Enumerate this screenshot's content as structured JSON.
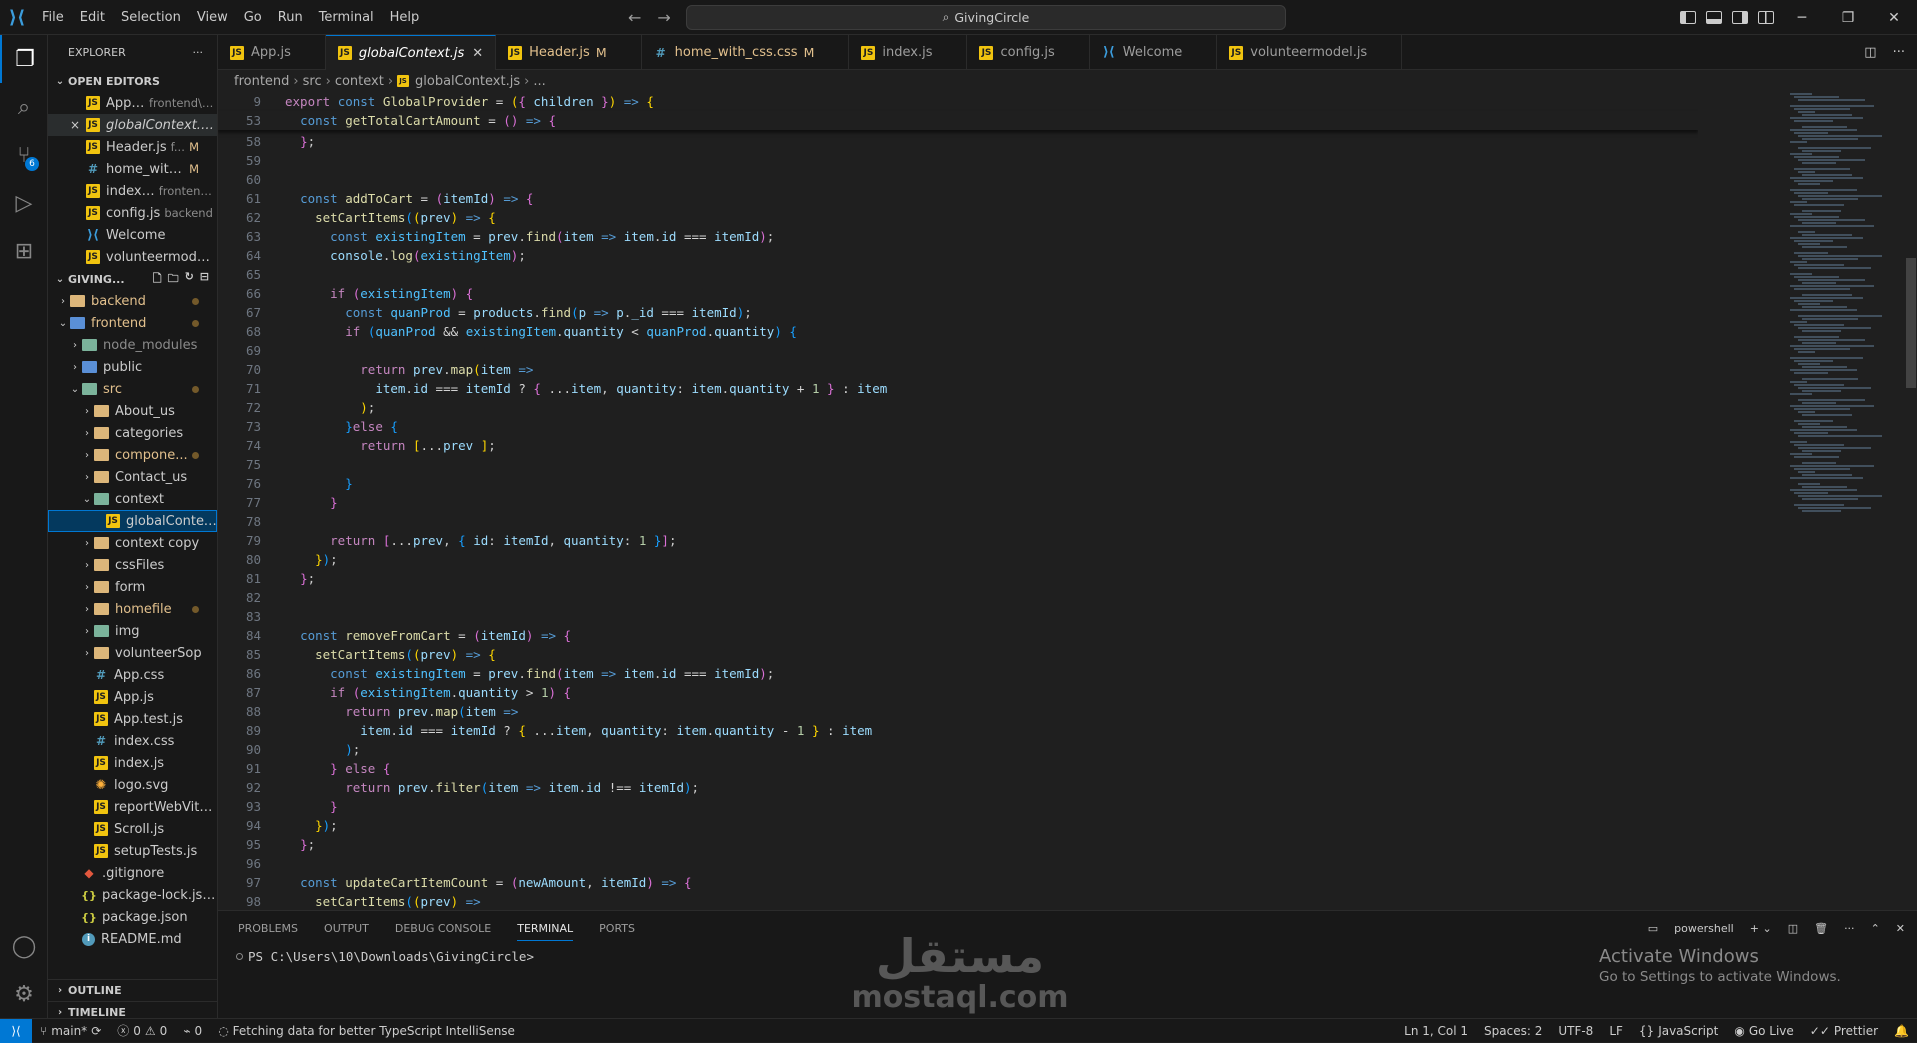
{
  "window": {
    "title": "GivingCircle"
  },
  "menu": [
    "File",
    "Edit",
    "Selection",
    "View",
    "Go",
    "Run",
    "Terminal",
    "Help"
  ],
  "activity": {
    "scm_badge": "6"
  },
  "explorer": {
    "title": "EXPLORER",
    "open_editors_label": "OPEN EDITORS",
    "open_editors": [
      {
        "name": "App.js",
        "desc": "frontend\\src",
        "mod": "",
        "icon": "js"
      },
      {
        "name": "globalContext.js...",
        "desc": "",
        "mod": "",
        "icon": "js",
        "close": "×"
      },
      {
        "name": "Header.js",
        "desc": "f...",
        "mod": "M",
        "icon": "js"
      },
      {
        "name": "home_with...",
        "desc": "",
        "mod": "M",
        "icon": "css"
      },
      {
        "name": "index.js",
        "desc": "frontend...",
        "mod": "",
        "icon": "js"
      },
      {
        "name": "config.js",
        "desc": "backend",
        "mod": "",
        "icon": "js"
      },
      {
        "name": "Welcome",
        "desc": "",
        "mod": "",
        "icon": "vs"
      },
      {
        "name": "volunteermodel...",
        "desc": "",
        "mod": "",
        "icon": "js"
      }
    ],
    "project_label": "GIVING...",
    "tree": [
      {
        "name": "backend",
        "indent": 0,
        "type": "folder",
        "open": false,
        "dot": true
      },
      {
        "name": "frontend",
        "indent": 0,
        "type": "folder",
        "open": true,
        "dot": true,
        "color": "blue"
      },
      {
        "name": "node_modules",
        "indent": 1,
        "type": "folder",
        "open": false,
        "dim": true,
        "color": "green"
      },
      {
        "name": "public",
        "indent": 1,
        "type": "folder",
        "open": false,
        "color": "blue"
      },
      {
        "name": "src",
        "indent": 1,
        "type": "folder",
        "open": true,
        "dot": true,
        "color": "green"
      },
      {
        "name": "About_us",
        "indent": 2,
        "type": "folder",
        "open": false
      },
      {
        "name": "categories",
        "indent": 2,
        "type": "folder",
        "open": false
      },
      {
        "name": "compone...",
        "indent": 2,
        "type": "folder",
        "open": false,
        "dot": true
      },
      {
        "name": "Contact_us",
        "indent": 2,
        "type": "folder",
        "open": false
      },
      {
        "name": "context",
        "indent": 2,
        "type": "folder",
        "open": true,
        "color": "green"
      },
      {
        "name": "globalContex...",
        "indent": 3,
        "type": "js",
        "selected": true
      },
      {
        "name": "context copy",
        "indent": 2,
        "type": "folder",
        "open": false
      },
      {
        "name": "cssFiles",
        "indent": 2,
        "type": "folder",
        "open": false
      },
      {
        "name": "form",
        "indent": 2,
        "type": "folder",
        "open": false
      },
      {
        "name": "homefile",
        "indent": 2,
        "type": "folder",
        "open": false,
        "dot": true
      },
      {
        "name": "img",
        "indent": 2,
        "type": "folder",
        "open": false,
        "color": "green"
      },
      {
        "name": "volunteerSop",
        "indent": 2,
        "type": "folder",
        "open": false
      },
      {
        "name": "App.css",
        "indent": 2,
        "type": "css"
      },
      {
        "name": "App.js",
        "indent": 2,
        "type": "js"
      },
      {
        "name": "App.test.js",
        "indent": 2,
        "type": "js"
      },
      {
        "name": "index.css",
        "indent": 2,
        "type": "css"
      },
      {
        "name": "index.js",
        "indent": 2,
        "type": "js"
      },
      {
        "name": "logo.svg",
        "indent": 2,
        "type": "svg"
      },
      {
        "name": "reportWebVital...",
        "indent": 2,
        "type": "js"
      },
      {
        "name": "Scroll.js",
        "indent": 2,
        "type": "js"
      },
      {
        "name": "setupTests.js",
        "indent": 2,
        "type": "js"
      },
      {
        "name": ".gitignore",
        "indent": 1,
        "type": "git"
      },
      {
        "name": "package-lock.json",
        "indent": 1,
        "type": "json"
      },
      {
        "name": "package.json",
        "indent": 1,
        "type": "json"
      },
      {
        "name": "README.md",
        "indent": 1,
        "type": "info"
      }
    ],
    "outline_label": "OUTLINE",
    "timeline_label": "TIMELINE"
  },
  "tabs": [
    {
      "name": "App.js",
      "icon": "js",
      "mod": "",
      "active": false
    },
    {
      "name": "globalContext.js",
      "icon": "js",
      "mod": "",
      "active": true
    },
    {
      "name": "Header.js",
      "icon": "js",
      "mod": "M",
      "active": false
    },
    {
      "name": "home_with_css.css",
      "icon": "css",
      "mod": "M",
      "active": false
    },
    {
      "name": "index.js",
      "icon": "js",
      "mod": "",
      "active": false
    },
    {
      "name": "config.js",
      "icon": "js",
      "mod": "",
      "active": false
    },
    {
      "name": "Welcome",
      "icon": "vs",
      "mod": "",
      "active": false
    },
    {
      "name": "volunteermodel.js",
      "icon": "js",
      "mod": "",
      "active": false
    }
  ],
  "breadcrumb": [
    "frontend",
    "src",
    "context",
    "globalContext.js",
    "..."
  ],
  "code_lines": [
    {
      "n": "9",
      "sticky": true,
      "html": "<span class='kwc'>export</span> <span class='kw'>const</span> <span class='fn'>GlobalProvider</span> <span class='op'>=</span> <span class='b1'>(</span><span class='b2'>{</span> <span class='var'>children</span> <span class='b2'>}</span><span class='b1'>)</span> <span class='kw'>=&gt;</span> <span class='b1'>{</span>"
    },
    {
      "n": "53",
      "sticky": true,
      "html": "  <span class='kw'>const</span> <span class='fn'>getTotalCartAmount</span> <span class='op'>=</span> <span class='b2'>()</span> <span class='kw'>=&gt;</span> <span class='b2'>{</span>"
    },
    {
      "n": "58",
      "html": "  <span class='b2'>}</span>;"
    },
    {
      "n": "59",
      "html": ""
    },
    {
      "n": "60",
      "html": ""
    },
    {
      "n": "61",
      "html": "  <span class='kw'>const</span> <span class='fn'>addToCart</span> <span class='op'>=</span> <span class='b2'>(</span><span class='var'>itemId</span><span class='b2'>)</span> <span class='kw'>=&gt;</span> <span class='b2'>{</span>"
    },
    {
      "n": "62",
      "html": "    <span class='fn'>setCartItems</span><span class='b3'>(</span><span class='b1'>(</span><span class='var'>prev</span><span class='b1'>)</span> <span class='kw'>=&gt;</span> <span class='b1'>{</span>"
    },
    {
      "n": "63",
      "html": "      <span class='kw'>const</span> <span class='cst'>existingItem</span> <span class='op'>=</span> <span class='var'>prev</span>.<span class='fn'>find</span><span class='b2'>(</span><span class='var'>item</span> <span class='kw'>=&gt;</span> <span class='var'>item</span>.<span class='var'>id</span> <span class='op'>===</span> <span class='var'>itemId</span><span class='b2'>)</span>;"
    },
    {
      "n": "64",
      "html": "      <span class='var'>console</span>.<span class='fn'>log</span><span class='b2'>(</span><span class='cst'>existingItem</span><span class='b2'>)</span>;"
    },
    {
      "n": "65",
      "html": ""
    },
    {
      "n": "66",
      "html": "      <span class='kwc'>if</span> <span class='b2'>(</span><span class='cst'>existingItem</span><span class='b2'>)</span> <span class='b2'>{</span>"
    },
    {
      "n": "67",
      "html": "        <span class='kw'>const</span> <span class='cst'>quanProd</span> <span class='op'>=</span> <span class='var'>products</span>.<span class='fn'>find</span><span class='b3'>(</span><span class='var'>p</span> <span class='kw'>=&gt;</span> <span class='var'>p</span>.<span class='var'>_id</span> <span class='op'>===</span> <span class='var'>itemId</span><span class='b3'>)</span>;"
    },
    {
      "n": "68",
      "html": "        <span class='kwc'>if</span> <span class='b3'>(</span><span class='cst'>quanProd</span> <span class='op'>&amp;&amp;</span> <span class='cst'>existingItem</span>.<span class='var'>quantity</span> <span class='op'>&lt;</span> <span class='cst'>quanProd</span>.<span class='var'>quantity</span><span class='b3'>)</span> <span class='b3'>{</span>"
    },
    {
      "n": "69",
      "html": ""
    },
    {
      "n": "70",
      "html": "          <span class='kwc'>return</span> <span class='var'>prev</span>.<span class='fn'>map</span><span class='b1'>(</span><span class='var'>item</span> <span class='kw'>=&gt;</span>"
    },
    {
      "n": "71",
      "html": "            <span class='var'>item</span>.<span class='var'>id</span> <span class='op'>===</span> <span class='var'>itemId</span> <span class='op'>?</span> <span class='b2'>{</span> <span class='op'>...</span><span class='var'>item</span>, <span class='var'>quantity</span>: <span class='var'>item</span>.<span class='var'>quantity</span> <span class='op'>+</span> <span class='num'>1</span> <span class='b2'>}</span> <span class='op'>:</span> <span class='var'>item</span>"
    },
    {
      "n": "72",
      "html": "          <span class='b1'>)</span>;"
    },
    {
      "n": "73",
      "html": "        <span class='b3'>}</span><span class='kwc'>else</span> <span class='b3'>{</span>"
    },
    {
      "n": "74",
      "html": "          <span class='kwc'>return</span> <span class='b1'>[</span><span class='op'>...</span><span class='var'>prev</span> <span class='b1'>]</span>;"
    },
    {
      "n": "75",
      "html": ""
    },
    {
      "n": "76",
      "html": "        <span class='b3'>}</span>"
    },
    {
      "n": "77",
      "html": "      <span class='b2'>}</span>"
    },
    {
      "n": "78",
      "html": ""
    },
    {
      "n": "79",
      "html": "      <span class='kwc'>return</span> <span class='b2'>[</span><span class='op'>...</span><span class='var'>prev</span>, <span class='b3'>{</span> <span class='var'>id</span>: <span class='var'>itemId</span>, <span class='var'>quantity</span>: <span class='num'>1</span> <span class='b3'>}</span><span class='b2'>]</span>;"
    },
    {
      "n": "80",
      "html": "    <span class='b1'>}</span><span class='b3'>)</span>;"
    },
    {
      "n": "81",
      "html": "  <span class='b2'>}</span>;"
    },
    {
      "n": "82",
      "html": ""
    },
    {
      "n": "83",
      "html": ""
    },
    {
      "n": "84",
      "html": "  <span class='kw'>const</span> <span class='fn'>removeFromCart</span> <span class='op'>=</span> <span class='b2'>(</span><span class='var'>itemId</span><span class='b2'>)</span> <span class='kw'>=&gt;</span> <span class='b2'>{</span>"
    },
    {
      "n": "85",
      "html": "    <span class='fn'>setCartItems</span><span class='b3'>(</span><span class='b1'>(</span><span class='var'>prev</span><span class='b1'>)</span> <span class='kw'>=&gt;</span> <span class='b1'>{</span>"
    },
    {
      "n": "86",
      "html": "      <span class='kw'>const</span> <span class='cst'>existingItem</span> <span class='op'>=</span> <span class='var'>prev</span>.<span class='fn'>find</span><span class='b2'>(</span><span class='var'>item</span> <span class='kw'>=&gt;</span> <span class='var'>item</span>.<span class='var'>id</span> <span class='op'>===</span> <span class='var'>itemId</span><span class='b2'>)</span>;"
    },
    {
      "n": "87",
      "html": "      <span class='kwc'>if</span> <span class='b2'>(</span><span class='cst'>existingItem</span>.<span class='var'>quantity</span> <span class='op'>&gt;</span> <span class='num'>1</span><span class='b2'>)</span> <span class='b2'>{</span>"
    },
    {
      "n": "88",
      "html": "        <span class='kwc'>return</span> <span class='var'>prev</span>.<span class='fn'>map</span><span class='b3'>(</span><span class='var'>item</span> <span class='kw'>=&gt;</span>"
    },
    {
      "n": "89",
      "html": "          <span class='var'>item</span>.<span class='var'>id</span> <span class='op'>===</span> <span class='var'>itemId</span> <span class='op'>?</span> <span class='b1'>{</span> <span class='op'>...</span><span class='var'>item</span>, <span class='var'>quantity</span>: <span class='var'>item</span>.<span class='var'>quantity</span> <span class='op'>-</span> <span class='num'>1</span> <span class='b1'>}</span> <span class='op'>:</span> <span class='var'>item</span>"
    },
    {
      "n": "90",
      "html": "        <span class='b3'>)</span>;"
    },
    {
      "n": "91",
      "html": "      <span class='b2'>}</span> <span class='kwc'>else</span> <span class='b2'>{</span>"
    },
    {
      "n": "92",
      "html": "        <span class='kwc'>return</span> <span class='var'>prev</span>.<span class='fn'>filter</span><span class='b3'>(</span><span class='var'>item</span> <span class='kw'>=&gt;</span> <span class='var'>item</span>.<span class='var'>id</span> <span class='op'>!==</span> <span class='var'>itemId</span><span class='b3'>)</span>;"
    },
    {
      "n": "93",
      "html": "      <span class='b2'>}</span>"
    },
    {
      "n": "94",
      "html": "    <span class='b1'>}</span><span class='b3'>)</span>;"
    },
    {
      "n": "95",
      "html": "  <span class='b2'>}</span>;"
    },
    {
      "n": "96",
      "html": ""
    },
    {
      "n": "97",
      "html": "  <span class='kw'>const</span> <span class='fn'>updateCartItemCount</span> <span class='op'>=</span> <span class='b2'>(</span><span class='var'>newAmount</span>, <span class='var'>itemId</span><span class='b2'>)</span> <span class='kw'>=&gt;</span> <span class='b2'>{</span>"
    },
    {
      "n": "98",
      "html": "    <span class='fn'>setCartItems</span><span class='b3'>(</span><span class='b1'>(</span><span class='var'>prev</span><span class='b1'>)</span> <span class='kw'>=&gt;</span>"
    }
  ],
  "panel": {
    "tabs": [
      "PROBLEMS",
      "OUTPUT",
      "DEBUG CONSOLE",
      "TERMINAL",
      "PORTS"
    ],
    "active_tab": "TERMINAL",
    "shell": "powershell",
    "prompt": "PS C:\\Users\\10\\Downloads\\GivingCircle>"
  },
  "activate": {
    "line1": "Activate Windows",
    "line2": "Go to Settings to activate Windows."
  },
  "watermark": {
    "arabic": "مستقل",
    "latin": "mostaql.com"
  },
  "status": {
    "branch": "main*",
    "errors": "0",
    "warnings": "0",
    "ports": "0",
    "message": "Fetching data for better TypeScript IntelliSense",
    "position": "Ln 1, Col 1",
    "spaces": "Spaces: 2",
    "encoding": "UTF-8",
    "eol": "LF",
    "language": "JavaScript",
    "golive": "Go Live",
    "prettier": "Prettier"
  }
}
